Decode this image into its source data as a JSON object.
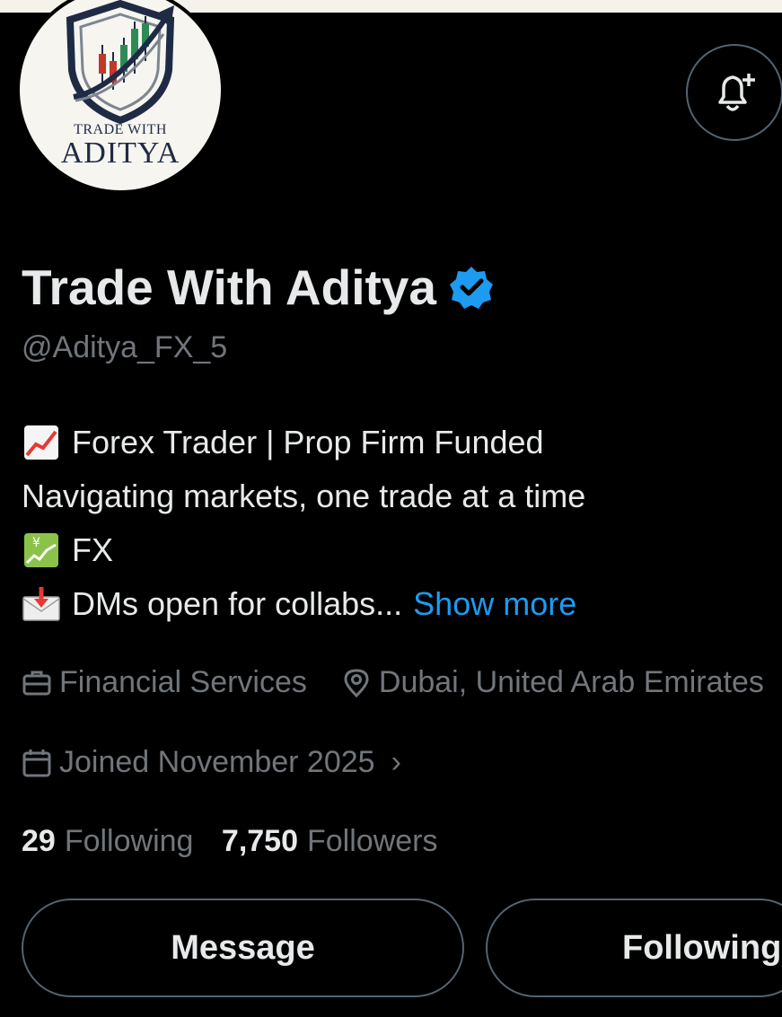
{
  "profile": {
    "display_name": "Trade With Aditya",
    "handle": "@Aditya_FX_5",
    "avatar": {
      "logo_line1": "TRADE WITH",
      "logo_line2": "ADITYA"
    },
    "verified": true
  },
  "bio": {
    "line1_emoji": "chart-increasing-emoji",
    "line1": "Forex Trader | Prop Firm Funded",
    "line2": "Navigating markets, one trade at a time",
    "line3_emoji": "chart-with-yen-emoji",
    "line3": "FX",
    "line4_emoji": "envelope-with-arrow-emoji",
    "line4": "DMs open for collabs...",
    "show_more": "Show more"
  },
  "meta": {
    "category_icon": "briefcase-icon",
    "category": "Financial Services",
    "location_icon": "location-pin-icon",
    "location": "Dubai, United Arab Emirates",
    "joined_icon": "calendar-icon",
    "joined": "Joined November 2025",
    "joined_arrow": "›"
  },
  "stats": {
    "following_count": "29",
    "following_label": "Following",
    "followers_count": "7,750",
    "followers_label": "Followers"
  },
  "actions": {
    "message_label": "Message",
    "following_label": "Following"
  },
  "colors": {
    "background": "#000000",
    "text_primary": "#e7e9ea",
    "text_secondary": "#71767b",
    "link": "#1d9bf0",
    "border": "#536471",
    "verified": "#1d9bf0"
  }
}
